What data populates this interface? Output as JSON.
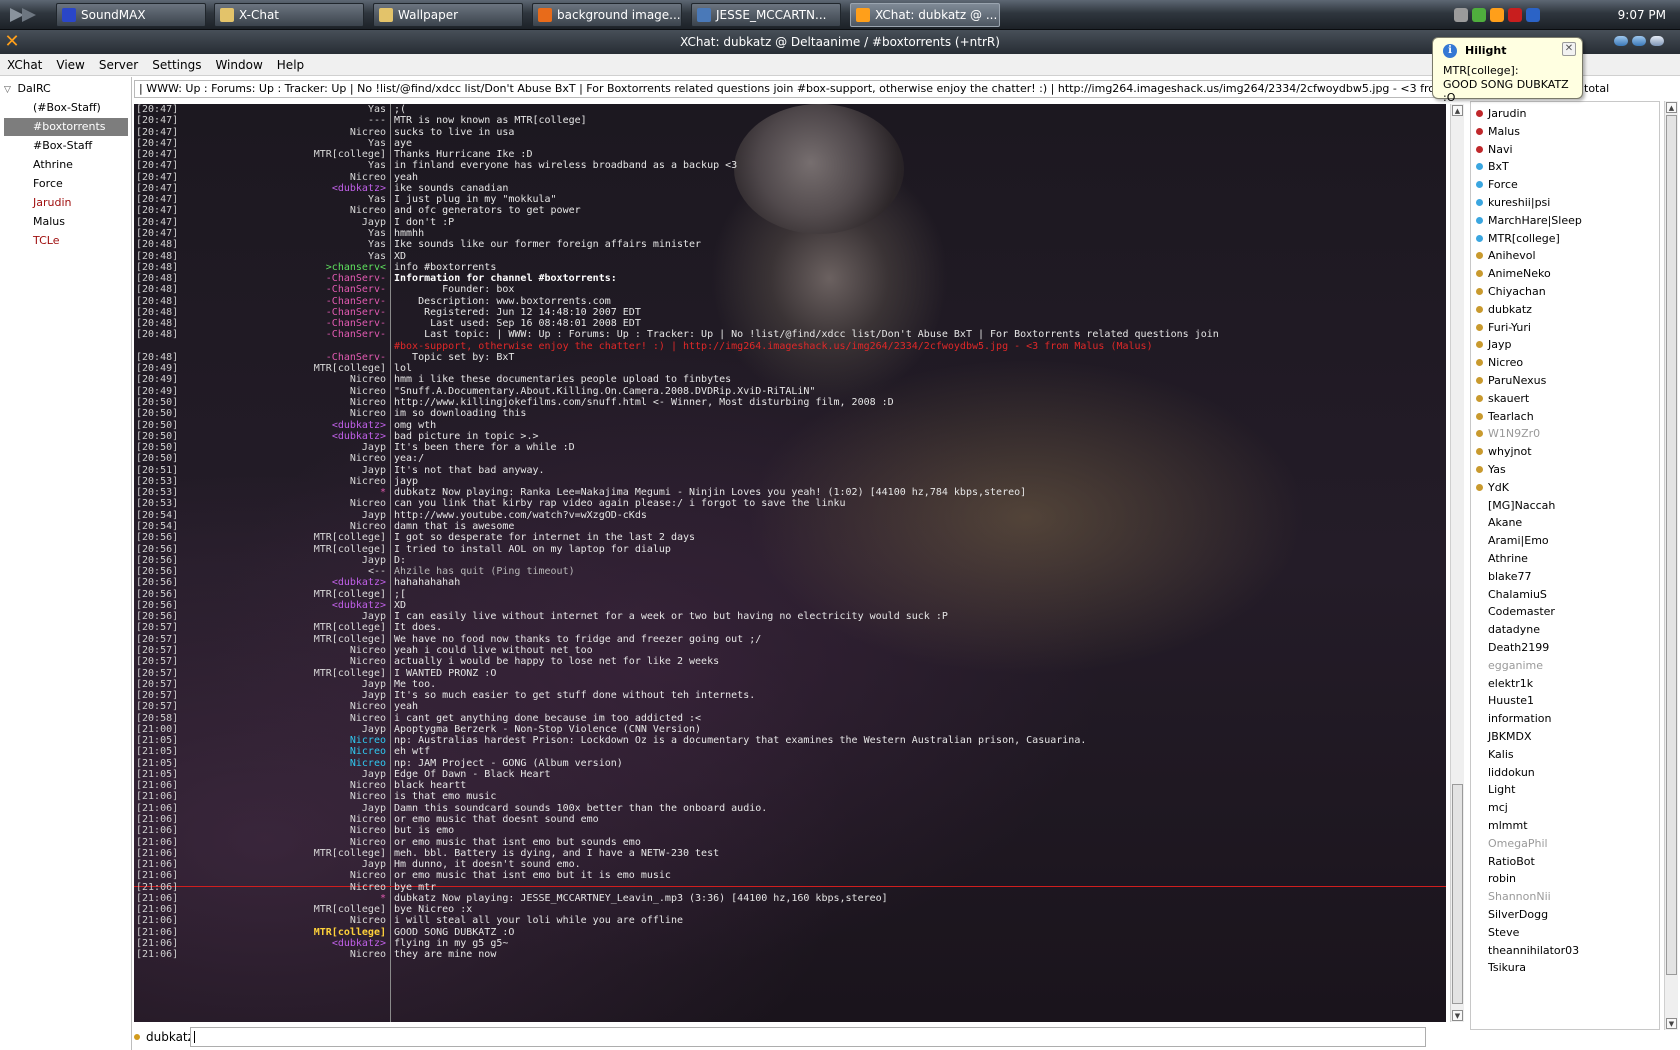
{
  "taskbar": {
    "tasks": [
      {
        "label": "SoundMAX",
        "color": "#2a46c8"
      },
      {
        "label": "X-Chat",
        "color": "#e3c36a"
      },
      {
        "label": "Wallpaper",
        "color": "#e3c36a"
      },
      {
        "label": "background image...",
        "color": "#e86b1a"
      },
      {
        "label": "JESSE_MCCARTN...",
        "color": "#4a79b8"
      },
      {
        "label": "XChat: dubkatz @ ...",
        "color": "#ff9f1a"
      }
    ],
    "clock": "9:07 PM"
  },
  "window": {
    "title": "XChat: dubkatz @ Deltaanime / #boxtorrents (+ntrR)",
    "icon_glyph": "✕"
  },
  "menu": [
    "XChat",
    "View",
    "Server",
    "Settings",
    "Window",
    "Help"
  ],
  "tree": {
    "server": "DaIRC",
    "items": [
      {
        "label": "(#Box-Staff)",
        "style": ""
      },
      {
        "label": "#boxtorrents",
        "style": "sel"
      },
      {
        "label": "#Box-Staff",
        "style": ""
      },
      {
        "label": "Athrine",
        "style": ""
      },
      {
        "label": "Force",
        "style": ""
      },
      {
        "label": "Jarudin",
        "style": "red"
      },
      {
        "label": "Malus",
        "style": ""
      },
      {
        "label": "TCLe",
        "style": "red"
      }
    ]
  },
  "topic": "| WWW: Up : Forums: Up : Tracker: Up | No !list/@find/xdcc list/Don't Abuse BxT | For Boxtorrents related questions join #box-support, otherwise enjoy the chatter! :) | http://img264.imageshack.us/img264/2334/2cfwoydbw5.jpg - <3 from Malus (Malus)",
  "user_count": "total",
  "balloon": {
    "title": "Hilight",
    "line1": "MTR[college]:",
    "line2": "GOOD SONG DUBKATZ :O",
    "close": "✕"
  },
  "input": {
    "nick": "dubkatz",
    "value": ""
  },
  "chat": [
    {
      "t": "[20:47]",
      "n": "Yas",
      "nc": "",
      "m": ";(",
      "mc": ""
    },
    {
      "t": "[20:47]",
      "n": "---",
      "nc": "",
      "m": "MTR is now known as MTR[college]",
      "mc": ""
    },
    {
      "t": "[20:47]",
      "n": "Nicreo",
      "nc": "",
      "m": "sucks to live in usa",
      "mc": ""
    },
    {
      "t": "[20:47]",
      "n": "Yas",
      "nc": "",
      "m": "aye",
      "mc": ""
    },
    {
      "t": "[20:47]",
      "n": "MTR[college]",
      "nc": "",
      "m": "Thanks Hurricane Ike :D",
      "mc": ""
    },
    {
      "t": "[20:47]",
      "n": "Yas",
      "nc": "",
      "m": "in finland everyone has wireless broadband as a backup <3",
      "mc": ""
    },
    {
      "t": "[20:47]",
      "n": "Nicreo",
      "nc": "",
      "m": "yeah",
      "mc": ""
    },
    {
      "t": "[20:47]",
      "n": "<dubkatz>",
      "nc": "purple",
      "m": "ike sounds canadian",
      "mc": ""
    },
    {
      "t": "[20:47]",
      "n": "Yas",
      "nc": "",
      "m": "I just plug in my \"mokkula\"",
      "mc": ""
    },
    {
      "t": "[20:47]",
      "n": "Nicreo",
      "nc": "",
      "m": "and ofc generators to get power",
      "mc": ""
    },
    {
      "t": "[20:47]",
      "n": "Jayp",
      "nc": "",
      "m": "I don't :P",
      "mc": ""
    },
    {
      "t": "[20:47]",
      "n": "Yas",
      "nc": "",
      "m": "hmmhh",
      "mc": ""
    },
    {
      "t": "[20:48]",
      "n": "Yas",
      "nc": "",
      "m": "Ike sounds like our former foreign affairs minister",
      "mc": ""
    },
    {
      "t": "[20:48]",
      "n": "Yas",
      "nc": "",
      "m": "XD",
      "mc": ""
    },
    {
      "t": "[20:48]",
      "n": ">chanserv<",
      "nc": "green",
      "m": "info #boxtorrents",
      "mc": ""
    },
    {
      "t": "[20:48]",
      "n": "-ChanServ-",
      "nc": "pink",
      "m": "Information for channel #boxtorrents:",
      "mc": "white"
    },
    {
      "t": "[20:48]",
      "n": "-ChanServ-",
      "nc": "pink",
      "m": "        Founder: box",
      "mc": ""
    },
    {
      "t": "[20:48]",
      "n": "-ChanServ-",
      "nc": "pink",
      "m": "    Description: www.boxtorrents.com",
      "mc": ""
    },
    {
      "t": "[20:48]",
      "n": "-ChanServ-",
      "nc": "pink",
      "m": "     Registered: Jun 12 14:48:10 2007 EDT",
      "mc": ""
    },
    {
      "t": "[20:48]",
      "n": "-ChanServ-",
      "nc": "pink",
      "m": "      Last used: Sep 16 08:48:01 2008 EDT",
      "mc": ""
    },
    {
      "t": "[20:48]",
      "n": "-ChanServ-",
      "nc": "pink",
      "m": "     Last topic: | WWW: Up : Forums: Up : Tracker: Up | No !list/@find/xdcc list/Don't Abuse BxT | For Boxtorrents related questions join",
      "mc": ""
    },
    {
      "t": "",
      "n": "",
      "nc": "",
      "m": "#box-support, otherwise enjoy the chatter! :) | http://img264.imageshack.us/img264/2334/2cfwoydbw5.jpg - <3 from Malus (Malus)",
      "mc": "red"
    },
    {
      "t": "[20:48]",
      "n": "-ChanServ-",
      "nc": "pink",
      "m": "   Topic set by: BxT",
      "mc": ""
    },
    {
      "t": "[20:49]",
      "n": "MTR[college]",
      "nc": "",
      "m": "lol",
      "mc": ""
    },
    {
      "t": "[20:49]",
      "n": "Nicreo",
      "nc": "",
      "m": "hmm i like these documentaries people upload to finbytes",
      "mc": ""
    },
    {
      "t": "[20:49]",
      "n": "Nicreo",
      "nc": "",
      "m": "\"Snuff.A.Documentary.About.Killing.On.Camera.2008.DVDRip.XviD-RiTALiN\"",
      "mc": ""
    },
    {
      "t": "[20:50]",
      "n": "Nicreo",
      "nc": "",
      "m": "http://www.killingjokefilms.com/snuff.html <- Winner, Most disturbing film, 2008 :D",
      "mc": ""
    },
    {
      "t": "[20:50]",
      "n": "Nicreo",
      "nc": "",
      "m": "im so downloading this",
      "mc": ""
    },
    {
      "t": "[20:50]",
      "n": "<dubkatz>",
      "nc": "purple",
      "m": "omg wth",
      "mc": ""
    },
    {
      "t": "[20:50]",
      "n": "<dubkatz>",
      "nc": "purple",
      "m": "bad picture in topic >.>",
      "mc": ""
    },
    {
      "t": "[20:50]",
      "n": "Jayp",
      "nc": "",
      "m": "It's been there for a while :D",
      "mc": ""
    },
    {
      "t": "[20:50]",
      "n": "Nicreo",
      "nc": "",
      "m": "yea:/",
      "mc": ""
    },
    {
      "t": "[20:51]",
      "n": "Jayp",
      "nc": "",
      "m": "It's not that bad anyway.",
      "mc": ""
    },
    {
      "t": "[20:53]",
      "n": "Nicreo",
      "nc": "",
      "m": "jayp",
      "mc": ""
    },
    {
      "t": "[20:53]",
      "n": "*",
      "nc": "pink",
      "m": "dubkatz Now playing: Ranka Lee=Nakajima Megumi - Ninjin Loves you yeah! (1:02) [44100 hz,784 kbps,stereo]",
      "mc": ""
    },
    {
      "t": "[20:53]",
      "n": "Nicreo",
      "nc": "",
      "m": "can you link that kirby rap video again please:/ i forgot to save the linku",
      "mc": ""
    },
    {
      "t": "[20:54]",
      "n": "Jayp",
      "nc": "",
      "m": "http://www.youtube.com/watch?v=wXzgOD-cKds",
      "mc": ""
    },
    {
      "t": "[20:54]",
      "n": "Nicreo",
      "nc": "",
      "m": "damn that is awesome",
      "mc": ""
    },
    {
      "t": "[20:56]",
      "n": "MTR[college]",
      "nc": "",
      "m": "I got so desperate for internet in the last 2 days",
      "mc": ""
    },
    {
      "t": "[20:56]",
      "n": "MTR[college]",
      "nc": "",
      "m": "I tried to install AOL on my laptop for dialup",
      "mc": ""
    },
    {
      "t": "[20:56]",
      "n": "Jayp",
      "nc": "",
      "m": "D:",
      "mc": ""
    },
    {
      "t": "[20:56]",
      "n": "<--",
      "nc": "",
      "m": "Ahzile has quit (Ping timeout)",
      "mc": "grey"
    },
    {
      "t": "[20:56]",
      "n": "<dubkatz>",
      "nc": "purple",
      "m": "hahahahahah",
      "mc": ""
    },
    {
      "t": "[20:56]",
      "n": "MTR[college]",
      "nc": "",
      "m": ";[",
      "mc": ""
    },
    {
      "t": "[20:56]",
      "n": "<dubkatz>",
      "nc": "purple",
      "m": "XD",
      "mc": ""
    },
    {
      "t": "[20:56]",
      "n": "Jayp",
      "nc": "",
      "m": "I can easily live without internet for a week or two but having no electricity would suck :P",
      "mc": ""
    },
    {
      "t": "[20:57]",
      "n": "MTR[college]",
      "nc": "",
      "m": "It does.",
      "mc": ""
    },
    {
      "t": "[20:57]",
      "n": "MTR[college]",
      "nc": "",
      "m": "We have no food now thanks to fridge and freezer going out ;/",
      "mc": ""
    },
    {
      "t": "[20:57]",
      "n": "Nicreo",
      "nc": "",
      "m": "yeah i could live without net too",
      "mc": ""
    },
    {
      "t": "[20:57]",
      "n": "Nicreo",
      "nc": "",
      "m": "actually i would be happy to lose net for like 2 weeks",
      "mc": ""
    },
    {
      "t": "[20:57]",
      "n": "MTR[college]",
      "nc": "",
      "m": "I WANTED PRONZ :O",
      "mc": ""
    },
    {
      "t": "[20:57]",
      "n": "Jayp",
      "nc": "",
      "m": "Me too.",
      "mc": ""
    },
    {
      "t": "[20:57]",
      "n": "Jayp",
      "nc": "",
      "m": "It's so much easier to get stuff done without teh internets.",
      "mc": ""
    },
    {
      "t": "[20:57]",
      "n": "Nicreo",
      "nc": "",
      "m": "yeah",
      "mc": ""
    },
    {
      "t": "[20:58]",
      "n": "Nicreo",
      "nc": "",
      "m": "i cant get anything done because im too addicted :<",
      "mc": ""
    },
    {
      "t": "[21:00]",
      "n": "Jayp",
      "nc": "",
      "m": "Apoptygma Berzerk - Non-Stop Violence (CNN Version)",
      "mc": ""
    },
    {
      "t": "[21:05]",
      "n": "Nicreo",
      "nc": "cyan",
      "m": "np: Australias hardest Prison: Lockdown Oz is a documentary that examines the Western Australian prison, Casuarina.",
      "mc": ""
    },
    {
      "t": "[21:05]",
      "n": "Nicreo",
      "nc": "cyan",
      "m": "eh wtf",
      "mc": ""
    },
    {
      "t": "[21:05]",
      "n": "Nicreo",
      "nc": "cyan",
      "m": "np: JAM Project - GONG (Album version)",
      "mc": ""
    },
    {
      "t": "[21:05]",
      "n": "Jayp",
      "nc": "",
      "m": "Edge Of Dawn - Black Heart",
      "mc": ""
    },
    {
      "t": "[21:06]",
      "n": "Nicreo",
      "nc": "",
      "m": "black heartt",
      "mc": ""
    },
    {
      "t": "[21:06]",
      "n": "Nicreo",
      "nc": "",
      "m": "is that emo music",
      "mc": ""
    },
    {
      "t": "[21:06]",
      "n": "Jayp",
      "nc": "",
      "m": "Damn this soundcard sounds 100x better than the onboard audio.",
      "mc": ""
    },
    {
      "t": "[21:06]",
      "n": "Nicreo",
      "nc": "",
      "m": "or emo music that doesnt sound emo",
      "mc": ""
    },
    {
      "t": "[21:06]",
      "n": "Nicreo",
      "nc": "",
      "m": "but is emo",
      "mc": ""
    },
    {
      "t": "[21:06]",
      "n": "Nicreo",
      "nc": "",
      "m": "or emo music that isnt emo but sounds emo",
      "mc": ""
    },
    {
      "t": "[21:06]",
      "n": "MTR[college]",
      "nc": "",
      "m": "meh. bbl. Battery is dying, and I have a NETW-230 test",
      "mc": ""
    },
    {
      "t": "[21:06]",
      "n": "Jayp",
      "nc": "",
      "m": "Hm dunno, it doesn't sound emo.",
      "mc": ""
    },
    {
      "t": "[21:06]",
      "n": "Nicreo",
      "nc": "",
      "m": "or emo music that isnt emo but it is emo music",
      "mc": ""
    },
    {
      "t": "[21:06]",
      "n": "Nicreo",
      "nc": "",
      "m": "bye mtr",
      "mc": ""
    },
    {
      "t": "[21:06]",
      "n": "*",
      "nc": "pink",
      "m": "dubkatz Now playing: JESSE_MCCARTNEY_Leavin_.mp3 (3:36) [44100 hz,160 kbps,stereo]",
      "mc": ""
    },
    {
      "t": "[21:06]",
      "n": "MTR[college]",
      "nc": "",
      "m": "bye Nicreo :x",
      "mc": ""
    },
    {
      "t": "[21:06]",
      "n": "Nicreo",
      "nc": "",
      "m": "i will steal all your loli while you are offline",
      "mc": ""
    },
    {
      "t": "[21:06]",
      "n": "MTR[college]",
      "nc": "yellow",
      "m": "GOOD SONG DUBKATZ :O",
      "mc": ""
    },
    {
      "t": "[21:06]",
      "n": "<dubkatz>",
      "nc": "purple",
      "m": "flying in my g5 g5~",
      "mc": ""
    },
    {
      "t": "[21:06]",
      "n": "Nicreo",
      "nc": "",
      "m": "they are mine now",
      "mc": ""
    }
  ],
  "users": [
    {
      "n": "Jarudin",
      "c": "#c0282b",
      "away": false
    },
    {
      "n": "Malus",
      "c": "#c0282b",
      "away": false
    },
    {
      "n": "Navi",
      "c": "#c0282b",
      "away": false
    },
    {
      "n": "BxT",
      "c": "#3aa6e0",
      "away": false
    },
    {
      "n": "Force",
      "c": "#3aa6e0",
      "away": false
    },
    {
      "n": "kureshii|psi",
      "c": "#3aa6e0",
      "away": false
    },
    {
      "n": "MarchHare|Sleep",
      "c": "#3aa6e0",
      "away": false
    },
    {
      "n": "MTR[college]",
      "c": "#3aa6e0",
      "away": false
    },
    {
      "n": "Anihevol",
      "c": "#c99a2e",
      "away": false
    },
    {
      "n": "AnimeNeko",
      "c": "#c99a2e",
      "away": false
    },
    {
      "n": "Chiyachan",
      "c": "#c99a2e",
      "away": false
    },
    {
      "n": "dubkatz",
      "c": "#c99a2e",
      "away": false
    },
    {
      "n": "Furi-Yuri",
      "c": "#c99a2e",
      "away": false
    },
    {
      "n": "Jayp",
      "c": "#c99a2e",
      "away": false
    },
    {
      "n": "Nicreo",
      "c": "#c99a2e",
      "away": false
    },
    {
      "n": "ParuNexus",
      "c": "#c99a2e",
      "away": false
    },
    {
      "n": "skauert",
      "c": "#c99a2e",
      "away": false
    },
    {
      "n": "Tearlach",
      "c": "#c99a2e",
      "away": false
    },
    {
      "n": "W1N9Zr0",
      "c": "#c99a2e",
      "away": true
    },
    {
      "n": "whyjnot",
      "c": "#c99a2e",
      "away": false
    },
    {
      "n": "Yas",
      "c": "#c99a2e",
      "away": false
    },
    {
      "n": "YdK",
      "c": "#c99a2e",
      "away": false
    },
    {
      "n": "[MG]Naccah",
      "c": "",
      "away": false
    },
    {
      "n": "Akane",
      "c": "",
      "away": false
    },
    {
      "n": "Arami|Emo",
      "c": "",
      "away": false
    },
    {
      "n": "Athrine",
      "c": "",
      "away": false
    },
    {
      "n": "blake77",
      "c": "",
      "away": false
    },
    {
      "n": "ChalamiuS",
      "c": "",
      "away": false
    },
    {
      "n": "Codemaster",
      "c": "",
      "away": false
    },
    {
      "n": "datadyne",
      "c": "",
      "away": false
    },
    {
      "n": "Death2199",
      "c": "",
      "away": false
    },
    {
      "n": "egganime",
      "c": "",
      "away": true
    },
    {
      "n": "elektr1k",
      "c": "",
      "away": false
    },
    {
      "n": "Huuste1",
      "c": "",
      "away": false
    },
    {
      "n": "information",
      "c": "",
      "away": false
    },
    {
      "n": "JBKMDX",
      "c": "",
      "away": false
    },
    {
      "n": "Kalis",
      "c": "",
      "away": false
    },
    {
      "n": "liddokun",
      "c": "",
      "away": false
    },
    {
      "n": "Light",
      "c": "",
      "away": false
    },
    {
      "n": "mcj",
      "c": "",
      "away": false
    },
    {
      "n": "mlmmt",
      "c": "",
      "away": false
    },
    {
      "n": "OmegaPhil",
      "c": "",
      "away": true
    },
    {
      "n": "RatioBot",
      "c": "",
      "away": false
    },
    {
      "n": "robin",
      "c": "",
      "away": false
    },
    {
      "n": "ShannonNii",
      "c": "",
      "away": true
    },
    {
      "n": "SilverDogg",
      "c": "",
      "away": false
    },
    {
      "n": "Steve",
      "c": "",
      "away": false
    },
    {
      "n": "theannihilator03",
      "c": "",
      "away": false
    },
    {
      "n": "Tsikura",
      "c": "",
      "away": false
    }
  ]
}
